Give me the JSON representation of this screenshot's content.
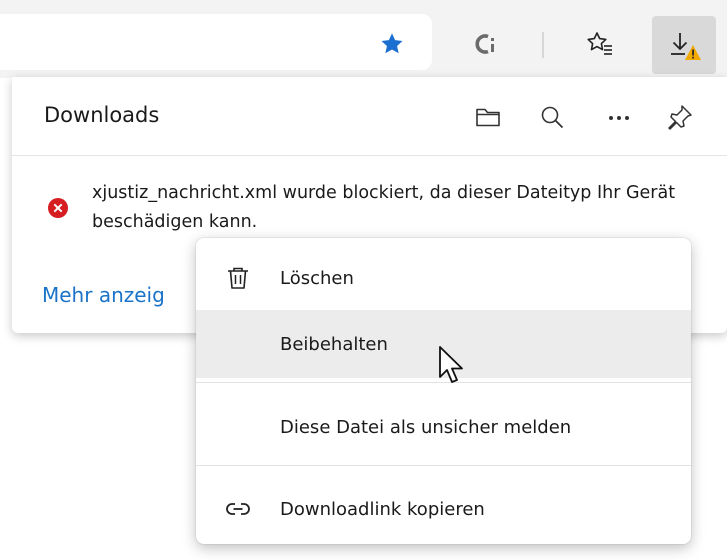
{
  "toolbar": {
    "star_icon": "filled-star-icon",
    "ci_icon": "ci-extension-icon",
    "favorites_icon": "favorites-icon",
    "downloads_icon": "download-warning-icon",
    "accent": "#1a73c8",
    "warning_color": "#f2a900"
  },
  "flyout": {
    "title": "Downloads",
    "icons": [
      "folder-icon",
      "search-icon",
      "more-icon",
      "pin-icon"
    ],
    "message": "xjustiz_nachricht.xml wurde blockiert, da dieser Dateityp Ihr Gerät beschädigen kann.",
    "error_color": "#d61d22",
    "more_link": "Mehr anzeig"
  },
  "context_menu": {
    "items": [
      {
        "label": "Löschen",
        "icon": "trash-icon"
      },
      {
        "label": "Beibehalten",
        "icon": ""
      },
      {
        "label": "Diese Datei als unsicher melden",
        "icon": ""
      },
      {
        "label": "Downloadlink kopieren",
        "icon": "link-icon"
      }
    ],
    "hovered": "Beibehalten"
  }
}
